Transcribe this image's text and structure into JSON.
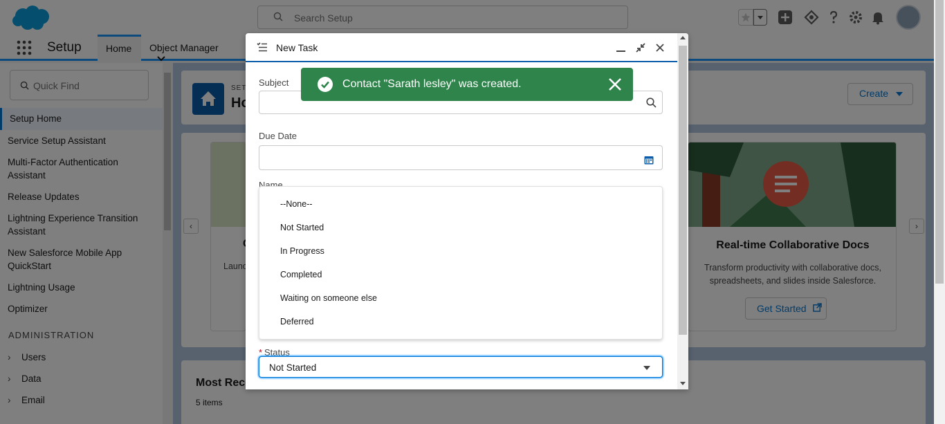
{
  "header": {
    "search_placeholder": "Search Setup"
  },
  "context_bar": {
    "app_name": "Setup",
    "tabs": [
      {
        "label": "Home"
      },
      {
        "label": "Object Manager"
      }
    ]
  },
  "sidebar": {
    "quick_find_placeholder": "Quick Find",
    "items": [
      {
        "label": "Setup Home"
      },
      {
        "label": "Service Setup Assistant"
      },
      {
        "label": "Multi-Factor Authentication Assistant"
      },
      {
        "label": "Release Updates"
      },
      {
        "label": "Lightning Experience Transition Assistant"
      },
      {
        "label": "New Salesforce Mobile App QuickStart"
      },
      {
        "label": "Lightning Usage"
      },
      {
        "label": "Optimizer"
      }
    ],
    "section_title": "ADMINISTRATION",
    "tree": [
      {
        "label": "Users"
      },
      {
        "label": "Data"
      },
      {
        "label": "Email"
      }
    ]
  },
  "main": {
    "header_eyebrow": "SETU",
    "header_title": "Ho",
    "create_label": "Create",
    "left_card_title": "C",
    "left_card_desc": "Launc",
    "right_card": {
      "title": "Real-time Collaborative Docs",
      "description": "Transform productivity with collaborative docs, spreadsheets, and slides inside Salesforce.",
      "button_label": "Get Started"
    },
    "recent": {
      "title": "Most Rece",
      "count": "5 items"
    }
  },
  "modal": {
    "title": "New Task",
    "fields": {
      "subject_label": "Subject",
      "due_date_label": "Due Date",
      "name_label": "Name",
      "status_required_marker": "*",
      "status_label": "Status",
      "status_value": "Not Started"
    },
    "status_options": [
      "--None--",
      "Not Started",
      "In Progress",
      "Completed",
      "Waiting on someone else",
      "Deferred"
    ]
  },
  "toast": {
    "message": "Contact \"Sarath lesley\" was created.",
    "color": "#2e844a"
  },
  "colors": {
    "brand": "#0176d3",
    "required": "#ba0517"
  }
}
